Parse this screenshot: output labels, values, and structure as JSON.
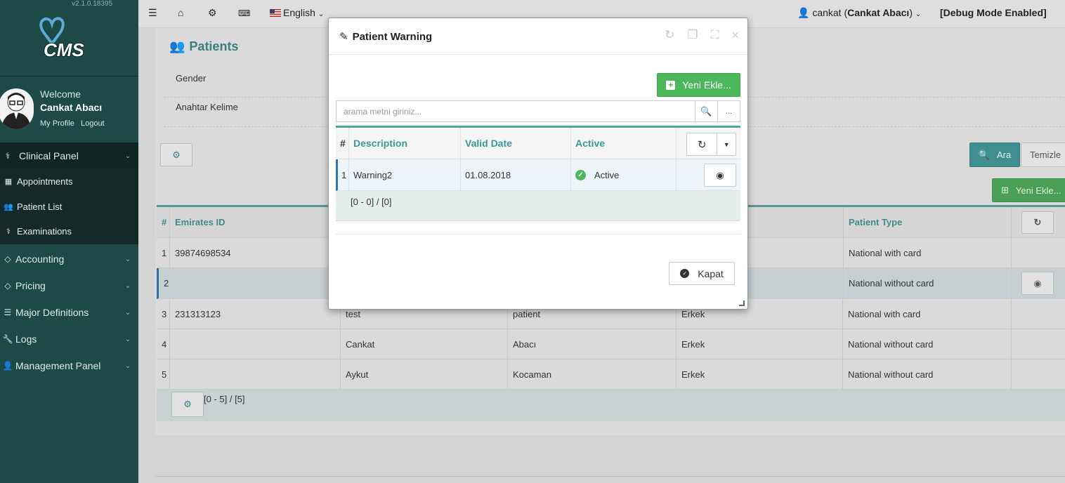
{
  "app": {
    "version": "v2.1.0.18395",
    "logo_text": "CMS"
  },
  "user": {
    "welcome": "Welcome",
    "name": "Cankat Abacı",
    "my_profile": "My Profile",
    "logout": "Logout"
  },
  "sidebar": {
    "items": [
      {
        "label": "Clinical Panel",
        "icon": "stethoscope-icon"
      },
      {
        "label": "Accounting",
        "icon": "tag-icon"
      },
      {
        "label": "Pricing",
        "icon": "tag-icon"
      },
      {
        "label": "Major Definitions",
        "icon": "list-icon"
      },
      {
        "label": "Logs",
        "icon": "wrench-icon"
      },
      {
        "label": "Management Panel",
        "icon": "user-icon"
      }
    ],
    "subitems": [
      {
        "label": "Appointments",
        "icon": "calendar-icon"
      },
      {
        "label": "Patient List",
        "icon": "users-icon"
      },
      {
        "label": "Examinations",
        "icon": "stethoscope-icon"
      }
    ]
  },
  "topbar": {
    "language": "English",
    "user_login": "cankat",
    "user_full": "Cankat Abacı",
    "debug": "[Debug Mode Enabled]"
  },
  "page": {
    "title": "Patients",
    "filter_gender": "Gender",
    "filter_keyword": "Anahtar Kelime",
    "search_button": "Ara",
    "clear_button": "Temizle",
    "add_button": "Yeni Ekle...",
    "table_headers": [
      "#",
      "Emirates ID",
      "Patient Type"
    ],
    "rows": [
      {
        "n": "1",
        "id": "39874698534",
        "first": "",
        "last": "",
        "gender": "",
        "type": "National with card"
      },
      {
        "n": "2",
        "id": "",
        "first": "",
        "last": "",
        "gender": "",
        "type": "National without card"
      },
      {
        "n": "3",
        "id": "231313123",
        "first": "test",
        "last": "patient",
        "gender": "Erkek",
        "type": "National with card"
      },
      {
        "n": "4",
        "id": "",
        "first": "Cankat",
        "last": "Abacı",
        "gender": "Erkek",
        "type": "National without card"
      },
      {
        "n": "5",
        "id": "",
        "first": "Aykut",
        "last": "Kocaman",
        "gender": "Erkek",
        "type": "National without card"
      }
    ],
    "pager": "[0 - 5] / [5]"
  },
  "modal": {
    "title": "Patient Warning",
    "add_button": "Yeni Ekle...",
    "search_placeholder": "arama metni giriniz...",
    "more_label": "...",
    "headers": {
      "hash": "#",
      "description": "Description",
      "valid_date": "Valid Date",
      "active": "Active"
    },
    "rows": [
      {
        "n": "1",
        "description": "Warning2",
        "valid_date": "01.08.2018",
        "active": "Active"
      }
    ],
    "pager": "[0 - 0] / [0]",
    "close_button": "Kapat"
  },
  "colors": {
    "sidebar_bg": "#1d4a47",
    "accent": "#3a9a99",
    "success": "#4cb85c",
    "selected_row": "#2f78b5"
  }
}
